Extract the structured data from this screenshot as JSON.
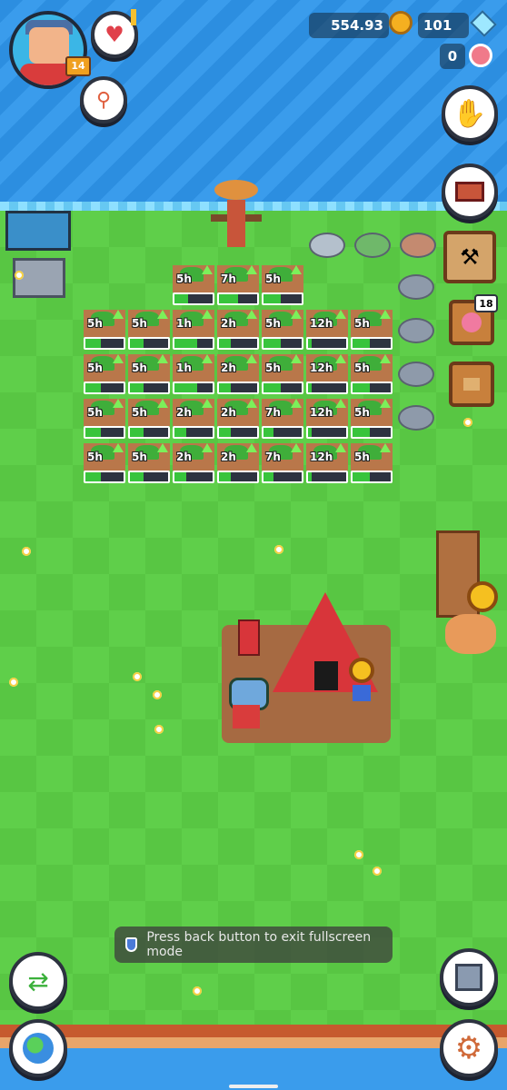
{
  "hud": {
    "coins": "554.93",
    "gems": "101",
    "flowers": "0",
    "player_level": "14"
  },
  "crafting_badge": "18",
  "toast": {
    "message": "Press back button to exit fullscreen mode"
  },
  "crop_rows": [
    [
      "5h",
      "7h",
      "5h"
    ],
    [
      "5h",
      "5h",
      "1h",
      "2h",
      "5h",
      "12h",
      "5h"
    ],
    [
      "5h",
      "5h",
      "1h",
      "2h",
      "5h",
      "12h",
      "5h"
    ],
    [
      "5h",
      "5h",
      "2h",
      "2h",
      "7h",
      "12h",
      "5h"
    ],
    [
      "5h",
      "5h",
      "2h",
      "2h",
      "7h",
      "12h",
      "5h"
    ]
  ],
  "crop_progress": [
    [
      0.35,
      0.5,
      0.45
    ],
    [
      0.4,
      0.35,
      0.6,
      0.3,
      0.45,
      0.1,
      0.45
    ],
    [
      0.4,
      0.35,
      0.6,
      0.3,
      0.45,
      0.1,
      0.45
    ],
    [
      0.4,
      0.35,
      0.3,
      0.3,
      0.25,
      0.1,
      0.45
    ],
    [
      0.4,
      0.35,
      0.3,
      0.3,
      0.25,
      0.1,
      0.45
    ]
  ],
  "icons": {
    "favorites": "heart-icon",
    "search": "magnifier-icon",
    "glove": "glove-icon",
    "toolbox": "toolbox-icon",
    "crafting": "crafting-icon",
    "trade": "trade-icon",
    "world": "globe-icon",
    "save": "floppy-disk-icon",
    "settings": "gear-icon"
  },
  "colors": {
    "water": "#2c8ee0",
    "grass": "#5fcf4a",
    "soil": "#b9774a",
    "progress": "#38c43c",
    "tent": "#d8353a"
  }
}
